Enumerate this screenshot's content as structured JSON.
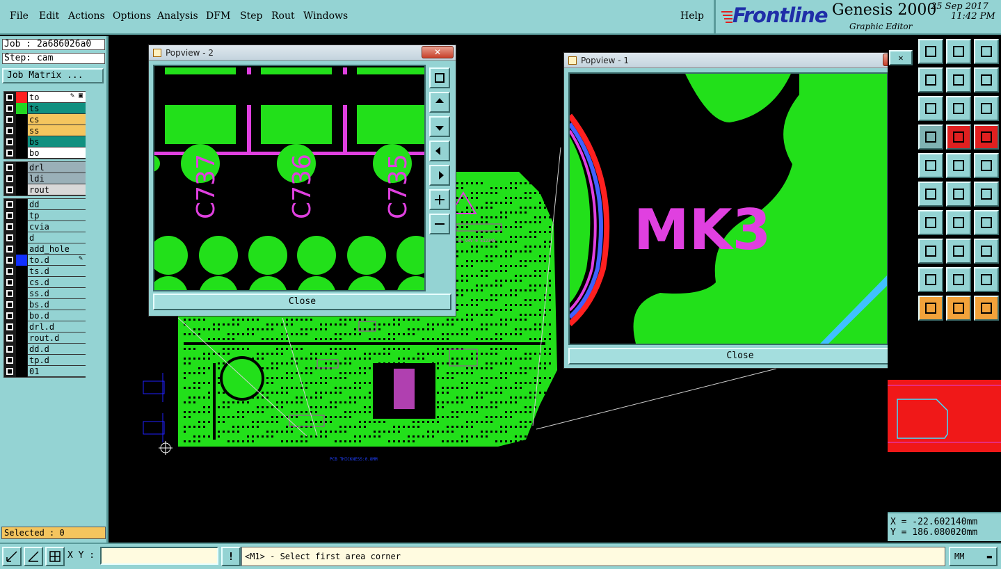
{
  "menu": {
    "items": [
      "File",
      "Edit",
      "Actions",
      "Options",
      "Analysis",
      "DFM",
      "Step",
      "Rout",
      "Windows"
    ],
    "help": "Help"
  },
  "brand": {
    "logo": "Frontline",
    "product": "Genesis 2000",
    "subtitle": "Graphic Editor",
    "date": "25 Sep 2017",
    "time": "11:42 PM"
  },
  "job": {
    "job_line": "Job : 2a686026a0",
    "step_line": "Step: cam",
    "matrix_button": "Job Matrix ..."
  },
  "layers": {
    "group1": [
      {
        "name": "to",
        "swatch": "#ff2020",
        "bg": "#ffffff",
        "flag": "✎ ▣"
      },
      {
        "name": "ts",
        "swatch": "#22d822",
        "bg": "#109080",
        "flag": ""
      },
      {
        "name": "cs",
        "swatch": "#000000",
        "bg": "#f4c55e",
        "flag": ""
      },
      {
        "name": "ss",
        "swatch": "#000000",
        "bg": "#f4c55e",
        "flag": ""
      },
      {
        "name": "bs",
        "swatch": "#000000",
        "bg": "#109080",
        "flag": ""
      },
      {
        "name": "bo",
        "swatch": "#000000",
        "bg": "#ffffff",
        "flag": ""
      }
    ],
    "group2": [
      {
        "name": "drl",
        "swatch": "#000000",
        "bg": "#9ab0b8",
        "flag": ""
      },
      {
        "name": "ldi",
        "swatch": "#000000",
        "bg": "#9ab0b8",
        "flag": ""
      },
      {
        "name": "rout",
        "swatch": "#000000",
        "bg": "#d8d8d8",
        "flag": ""
      }
    ],
    "group3": [
      {
        "name": "dd",
        "swatch": "#000000",
        "bg": "#94d3d3",
        "flag": ""
      },
      {
        "name": "tp",
        "swatch": "#000000",
        "bg": "#94d3d3",
        "flag": ""
      },
      {
        "name": "cvia",
        "swatch": "#000000",
        "bg": "#94d3d3",
        "flag": ""
      },
      {
        "name": "d",
        "swatch": "#000000",
        "bg": "#94d3d3",
        "flag": ""
      },
      {
        "name": "add_hole",
        "swatch": "#000000",
        "bg": "#94d3d3",
        "flag": ""
      },
      {
        "name": "to.d",
        "swatch": "#1030ff",
        "bg": "#94d3d3",
        "flag": "✎"
      },
      {
        "name": "ts.d",
        "swatch": "#000000",
        "bg": "#94d3d3",
        "flag": ""
      },
      {
        "name": "cs.d",
        "swatch": "#000000",
        "bg": "#94d3d3",
        "flag": ""
      },
      {
        "name": "ss.d",
        "swatch": "#000000",
        "bg": "#94d3d3",
        "flag": ""
      },
      {
        "name": "bs.d",
        "swatch": "#000000",
        "bg": "#94d3d3",
        "flag": ""
      },
      {
        "name": "bo.d",
        "swatch": "#000000",
        "bg": "#94d3d3",
        "flag": ""
      },
      {
        "name": "drl.d",
        "swatch": "#000000",
        "bg": "#94d3d3",
        "flag": ""
      },
      {
        "name": "rout.d",
        "swatch": "#000000",
        "bg": "#94d3d3",
        "flag": ""
      },
      {
        "name": "dd.d",
        "swatch": "#000000",
        "bg": "#94d3d3",
        "flag": ""
      },
      {
        "name": "tp.d",
        "swatch": "#000000",
        "bg": "#94d3d3",
        "flag": ""
      },
      {
        "name": "01",
        "swatch": "#000000",
        "bg": "#94d3d3",
        "flag": ""
      }
    ]
  },
  "selected": "Selected : 0",
  "board": {
    "thickness_label": "PCB THICKNESS:0.8MM",
    "note_label": "UL 94V-0 E12345"
  },
  "popview2": {
    "title": "Popview - 2",
    "close": "Close",
    "close_x": "✕",
    "labels": [
      "C737",
      "C736",
      "C735"
    ]
  },
  "popview1": {
    "title": "Popview - 1",
    "close": "Close",
    "close_x": "✕",
    "label": "MK3"
  },
  "coords": {
    "x": "X = -22.602140mm",
    "y": "Y = 186.080020mm"
  },
  "bottom": {
    "xy_label": "X Y :",
    "xy_value": "",
    "alert": "!",
    "status": "<M1> - Select first area corner",
    "units": "MM"
  },
  "colors": {
    "panel": "#94d3d3",
    "copper": "#22e01a",
    "silk": "#e040e0",
    "board_bg": "#000000"
  }
}
